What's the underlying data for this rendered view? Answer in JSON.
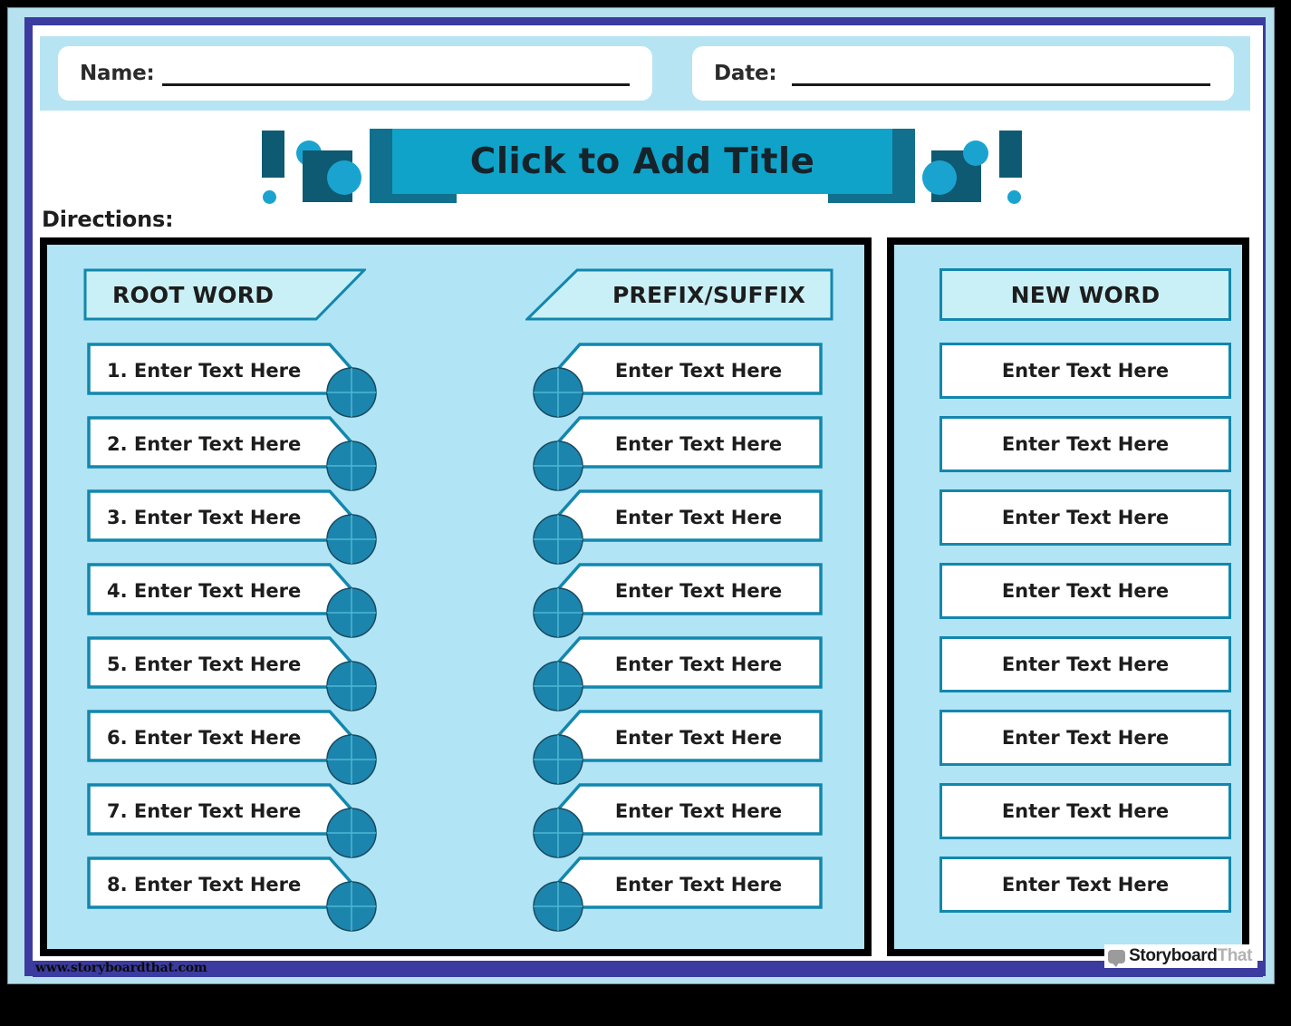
{
  "header": {
    "name_label": "Name:",
    "date_label": "Date:",
    "name_value": "",
    "date_value": ""
  },
  "title": {
    "text": "Click to Add Title"
  },
  "directions": {
    "label": "Directions:",
    "text": ""
  },
  "columns": {
    "root_word": "ROOT WORD",
    "prefix_suffix": "PREFIX/SUFFIX",
    "new_word": "NEW WORD"
  },
  "rows": {
    "root_word": [
      "1. Enter Text Here",
      "2. Enter Text Here",
      "3. Enter Text Here",
      "4. Enter Text Here",
      "5. Enter Text Here",
      "6. Enter Text Here",
      "7. Enter Text Here",
      "8. Enter Text Here"
    ],
    "prefix_suffix": [
      "Enter Text Here",
      "Enter Text Here",
      "Enter Text Here",
      "Enter Text Here",
      "Enter Text Here",
      "Enter Text Here",
      "Enter Text Here",
      "Enter Text Here"
    ],
    "new_word": [
      "Enter Text Here",
      "Enter Text Here",
      "Enter Text Here",
      "Enter Text Here",
      "Enter Text Here",
      "Enter Text Here",
      "Enter Text Here",
      "Enter Text Here"
    ]
  },
  "footer": {
    "url": "www.storyboardthat.com",
    "logo_primary": "Storyboard",
    "logo_secondary": "That"
  },
  "colors": {
    "accent_teal": "#0fa3c9",
    "deep_teal": "#0e5a72",
    "circle_teal": "#1c85ad",
    "border_teal": "#1287ad",
    "panel_blue": "#b1e4f5",
    "header_fill": "#c9f0f6",
    "frame_indigo": "#3b3ba0",
    "mat_blue": "#b6e1ef",
    "ink": "#1d1d1d"
  }
}
